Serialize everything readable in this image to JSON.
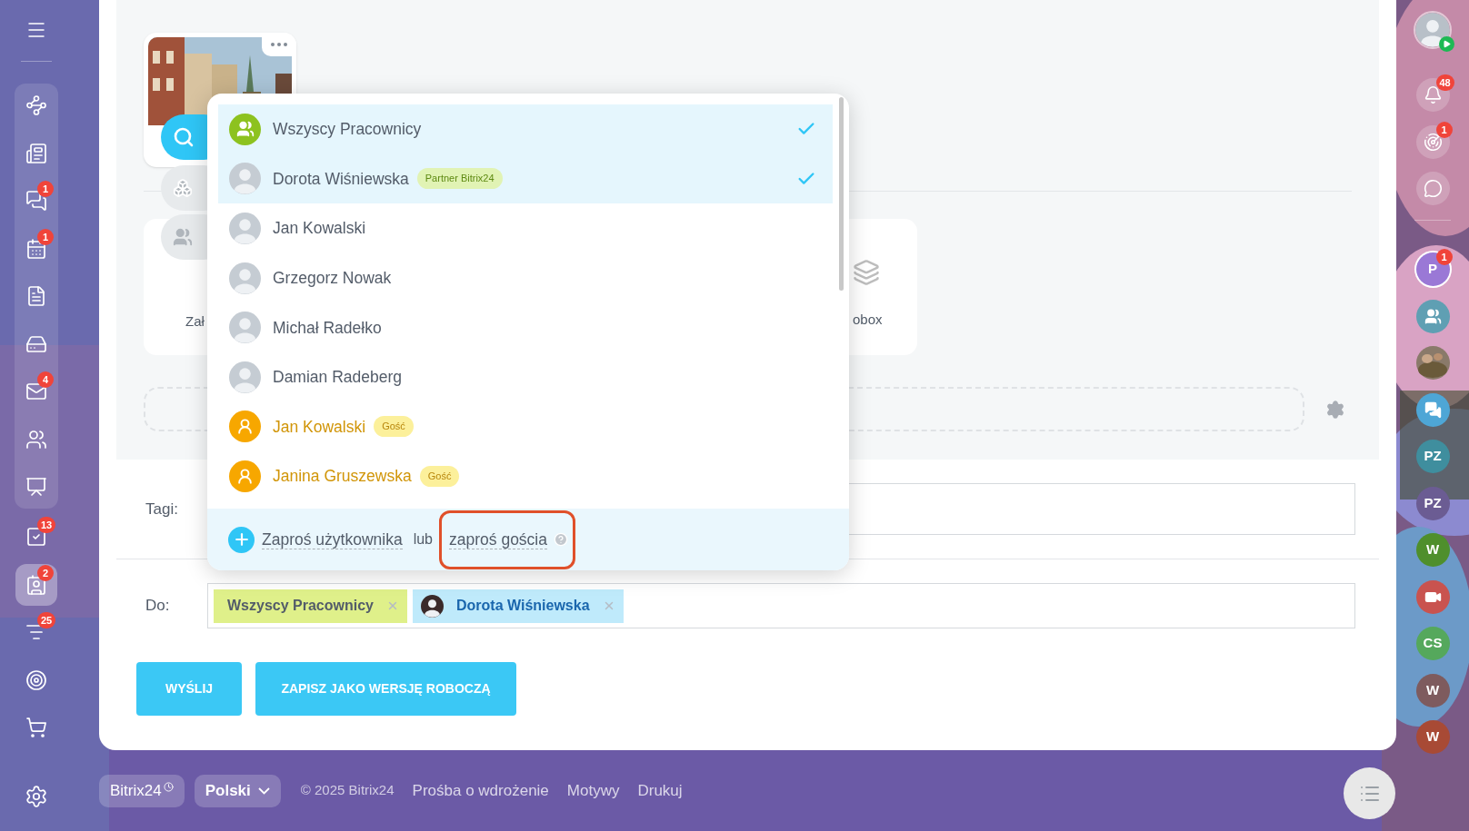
{
  "left_sidebar": {
    "pinned": [
      {
        "selected": false
      },
      {
        "selected": false
      },
      {
        "badge": "1",
        "selected": false
      },
      {
        "badge": "1",
        "selected": false
      },
      {
        "selected": false
      },
      {
        "selected": false
      },
      {
        "badge": "4",
        "selected": false
      },
      {
        "selected": false
      },
      {
        "selected": false
      }
    ],
    "items": [
      {
        "badge": "13",
        "selected": false
      },
      {
        "badge": "2",
        "selected": true
      },
      {
        "badge": "25",
        "selected": false
      },
      {
        "selected": false
      },
      {
        "selected": false
      }
    ]
  },
  "composer": {
    "sources": [
      {
        "label": "Zał"
      },
      {
        "label": "obox"
      }
    ],
    "tags_label": "Tagi:",
    "to_label": "Do:",
    "recipients": [
      {
        "kind": "group",
        "name": "Wszyscy Pracownicy"
      },
      {
        "kind": "user",
        "name": "Dorota Wiśniewska"
      }
    ],
    "buttons": [
      "WYŚLIJ",
      "ZAPISZ JAKO WERSJĘ ROBOCZĄ"
    ]
  },
  "selector": {
    "items": [
      {
        "kind": "group",
        "name": "Wszyscy Pracownicy",
        "selected": true
      },
      {
        "kind": "user",
        "name": "Dorota Wiśniewska",
        "badge": {
          "kind": "partner",
          "text": "Partner Bitrix24"
        },
        "selected": true
      },
      {
        "kind": "user",
        "name": "Jan Kowalski",
        "selected": false
      },
      {
        "kind": "user",
        "name": "Grzegorz Nowak",
        "selected": false
      },
      {
        "kind": "user",
        "name": "Michał Radełko",
        "selected": false
      },
      {
        "kind": "user",
        "name": "Damian Radeberg",
        "selected": false
      },
      {
        "kind": "guest",
        "name": "Jan Kowalski",
        "badge": {
          "kind": "guest",
          "text": "Gość"
        },
        "selected": false
      },
      {
        "kind": "guest",
        "name": "Janina Gruszewska",
        "badge": {
          "kind": "guest",
          "text": "Gość"
        },
        "selected": false
      }
    ],
    "footer": {
      "invite_user": "Zaproś użytkownika",
      "or": "lub",
      "invite_guest": "zaproś gościa",
      "invite_guest_highlighted": true
    }
  },
  "footer": {
    "brand": "Bitrix24",
    "language": "Polski",
    "copyright": "© 2025 Bitrix24",
    "links": [
      "Prośba o wdrożenie",
      "Motywy",
      "Drukuj"
    ]
  },
  "right_sidebar": {
    "items": [
      {
        "kind": "user"
      },
      {
        "kind": "icon",
        "badge": "48"
      },
      {
        "kind": "icon",
        "badge": "1"
      },
      {
        "kind": "icon"
      },
      {
        "kind": "initials",
        "text": "P",
        "color": "#9a78d6",
        "badge": "1"
      },
      {
        "kind": "icon",
        "color": "#5f9fb3"
      },
      {
        "kind": "picture"
      },
      {
        "kind": "icon",
        "color": "#4ea6d6"
      },
      {
        "kind": "initials",
        "text": "PZ",
        "color": "#3f8e9e"
      },
      {
        "kind": "initials",
        "text": "PZ",
        "color": "#6b5c93"
      },
      {
        "kind": "initials",
        "text": "W",
        "color": "#4f8f2c"
      },
      {
        "kind": "icon",
        "color": "#c9534f"
      },
      {
        "kind": "initials",
        "text": "CS",
        "color": "#55a85c"
      },
      {
        "kind": "initials",
        "text": "W",
        "color": "#7e5b5e"
      },
      {
        "kind": "initials",
        "text": "W",
        "color": "#a84a35"
      }
    ]
  }
}
